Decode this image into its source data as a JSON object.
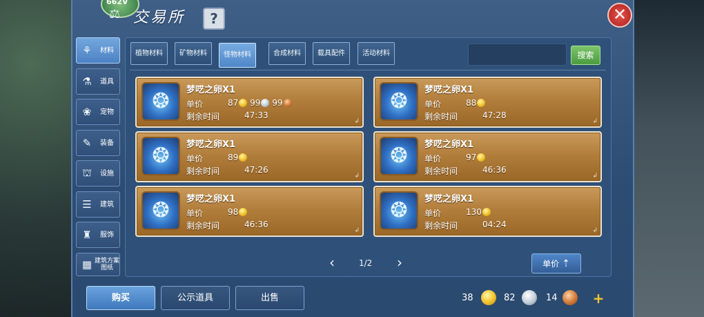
{
  "header": {
    "title": "交易所",
    "emblem_text": "662V",
    "help_label": "?",
    "close_label": "✕"
  },
  "sidebar": {
    "items": [
      {
        "label": "材料",
        "icon": "materials-icon",
        "glyph": "⚘"
      },
      {
        "label": "道具",
        "icon": "flask-icon",
        "glyph": "⚗"
      },
      {
        "label": "宠物",
        "icon": "paw-icon",
        "glyph": "❀"
      },
      {
        "label": "装备",
        "icon": "equipment-icon",
        "glyph": "✎"
      },
      {
        "label": "设施",
        "icon": "facility-icon",
        "glyph": "⛫"
      },
      {
        "label": "建筑",
        "icon": "building-icon",
        "glyph": "☰"
      },
      {
        "label": "服饰",
        "icon": "clothing-icon",
        "glyph": "♜"
      },
      {
        "label": "建筑方案图纸",
        "icon": "blueprint-icon",
        "glyph": "▦"
      }
    ]
  },
  "tabs": [
    {
      "label": "植物材料"
    },
    {
      "label": "矿物材料"
    },
    {
      "label": "怪物材料"
    },
    {
      "label": "合成材料"
    },
    {
      "label": "载具配件"
    },
    {
      "label": "活动材料"
    }
  ],
  "search": {
    "button_label": "搜索",
    "placeholder": ""
  },
  "labels": {
    "price": "单价",
    "time": "剩余时间"
  },
  "listings": [
    {
      "name": "梦呓之卵X1",
      "gold": "87",
      "silver": "99",
      "copper": "99",
      "time": "47:33"
    },
    {
      "name": "梦呓之卵X1",
      "gold": "88",
      "time": "47:28"
    },
    {
      "name": "梦呓之卵X1",
      "gold": "89",
      "time": "47:26"
    },
    {
      "name": "梦呓之卵X1",
      "gold": "97",
      "time": "46:36"
    },
    {
      "name": "梦呓之卵X1",
      "gold": "98",
      "time": "46:36"
    },
    {
      "name": "梦呓之卵X1",
      "gold": "130",
      "time": "04:24"
    }
  ],
  "pagination": {
    "label": "1/2",
    "prev": "‹",
    "next": "›"
  },
  "sort": {
    "label": "单价",
    "icon": "sort-arrow-icon"
  },
  "bottom": {
    "buy": "购买",
    "public": "公示道具",
    "sell": "出售"
  },
  "wallet": {
    "gold": "38",
    "silver": "82",
    "copper": "14",
    "add": "+"
  },
  "colors": {
    "gold": "#f3c531",
    "silver": "#c7d2dc",
    "copper": "#d47f3f",
    "card": "#b27e3c",
    "panel": "#2c4c73"
  }
}
